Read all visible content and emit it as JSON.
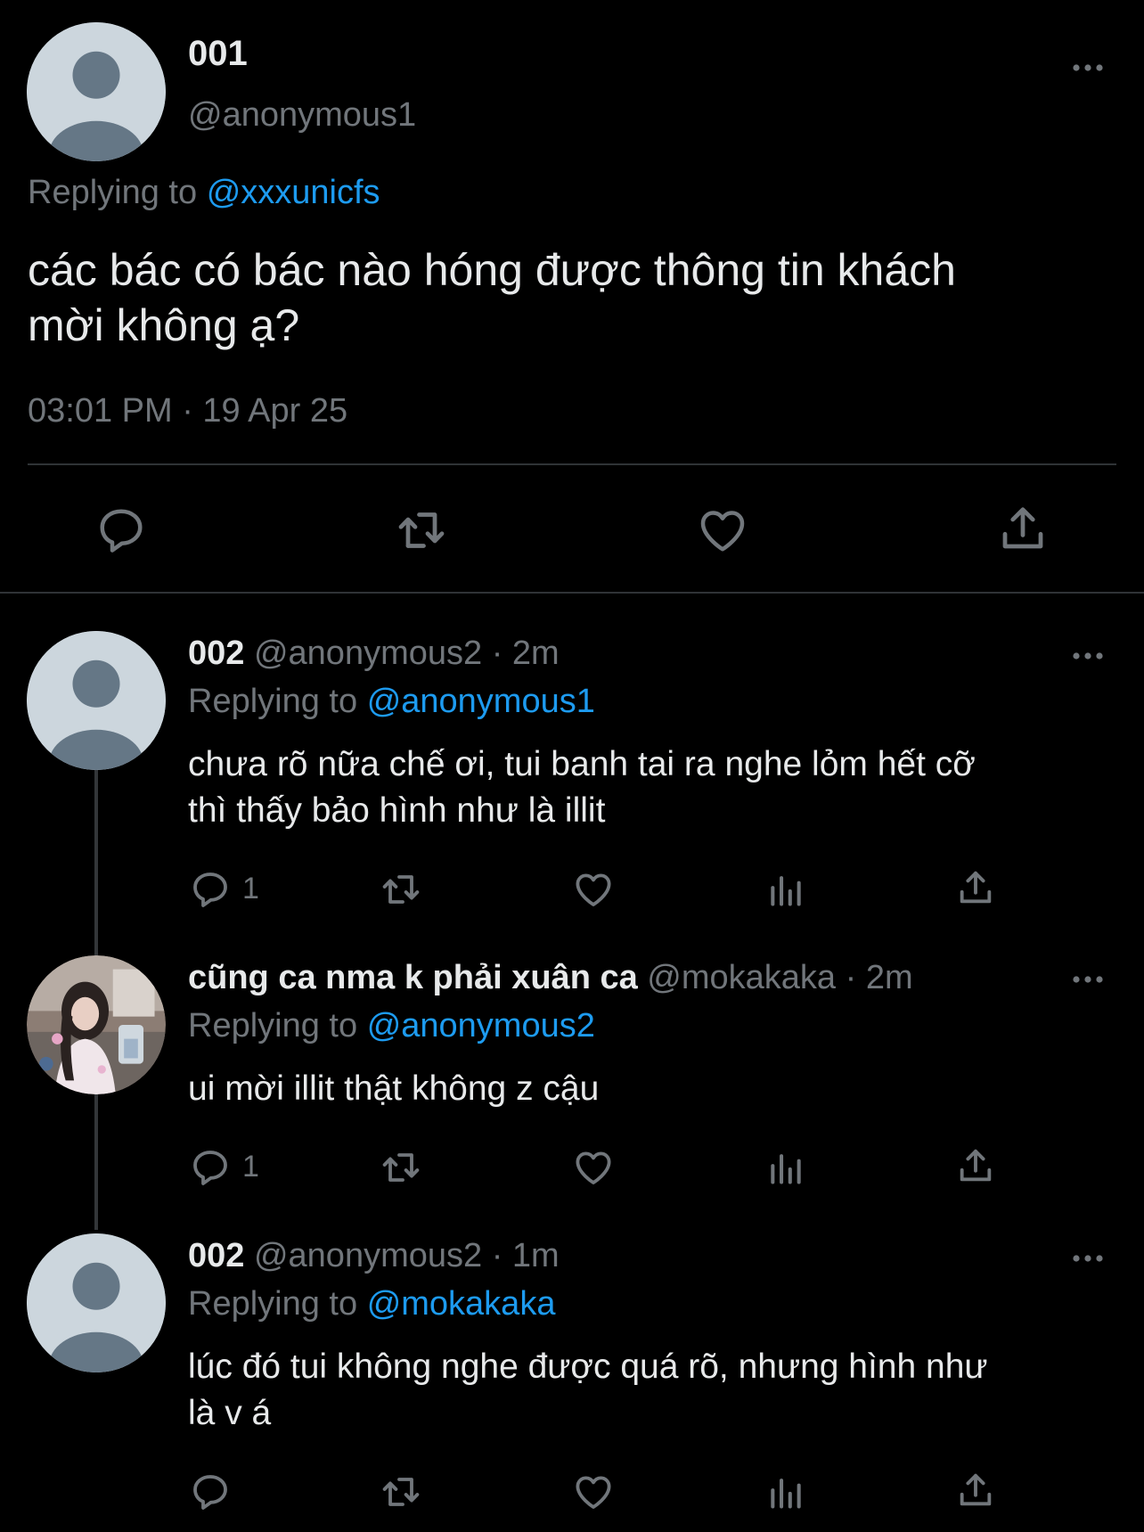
{
  "main_tweet": {
    "display_name": "001",
    "handle": "@anonymous1",
    "replying_prefix": "Replying to",
    "replying_to": "@xxxunicfs",
    "text_line1": "các bác có bác nào hóng được thông tin khách",
    "text_line2": "mời không ạ?",
    "timestamp": "03:01 PM · 19 Apr 25"
  },
  "replies": [
    {
      "display_name": "002",
      "handle": "@anonymous2 · 2m",
      "replying_prefix": "Replying to",
      "replying_to": "@anonymous1",
      "text_line1": "chưa rõ nữa chế ơi, tui banh tai ra nghe lỏm hết cỡ",
      "text_line2": "thì thấy bảo hình như là illit",
      "reply_count": "1"
    },
    {
      "display_name": "cũng ca nma k phải xuân ca",
      "handle": "@mokakaka · 2m",
      "replying_prefix": "Replying to",
      "replying_to": "@anonymous2",
      "text_line1": "ui mời illit thật không z cậu",
      "reply_count": "1"
    },
    {
      "display_name": "002",
      "handle": "@anonymous2 · 1m",
      "replying_prefix": "Replying to",
      "replying_to": "@mokakaka",
      "text_line1": "lúc đó tui không nghe được quá rõ, nhưng hình như",
      "text_line2": "là v á"
    }
  ],
  "icons": {
    "reply": "reply-icon",
    "retweet": "retweet-icon",
    "like": "like-icon",
    "views": "views-icon",
    "share": "share-icon",
    "more": "more-icon"
  },
  "colors": {
    "background": "#000000",
    "text": "#e7e9ea",
    "secondary": "#71767b",
    "link": "#1d9bf0",
    "avatar_bg": "#ccd6dd",
    "avatar_fg": "#657786"
  }
}
